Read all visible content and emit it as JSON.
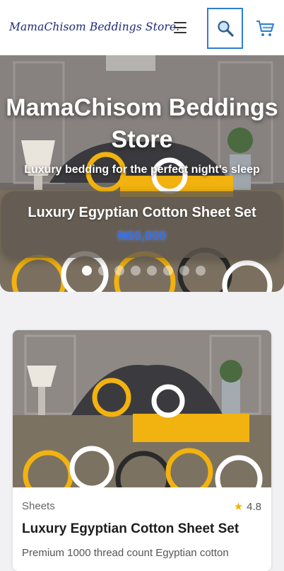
{
  "header": {
    "brand": "MamaChisom Beddings Store.",
    "icons": {
      "menu": "hamburger-menu-icon",
      "search": "search-icon",
      "cart": "cart-icon"
    }
  },
  "hero": {
    "title": "MamaChisom Beddings Store",
    "subtitle": "Luxury bedding for the perfect night's sleep",
    "slide": {
      "title": "Luxury Egyptian Cotton Sheet Set",
      "price": "₦60,000"
    },
    "dots": [
      "1",
      "2",
      "3",
      "4",
      "5",
      "6",
      "7",
      "8"
    ],
    "active_dot": 0
  },
  "product": {
    "category": "Sheets",
    "rating": "4.8",
    "title": "Luxury Egyptian Cotton Sheet Set",
    "description": "Premium 1000 thread count Egyptian cotton"
  },
  "colors": {
    "accent": "#2f7fd0",
    "brand": "#1f2a78",
    "price": "#3c6fe0",
    "star": "#f0b400",
    "bedding_yellow": "#f2b20f"
  }
}
